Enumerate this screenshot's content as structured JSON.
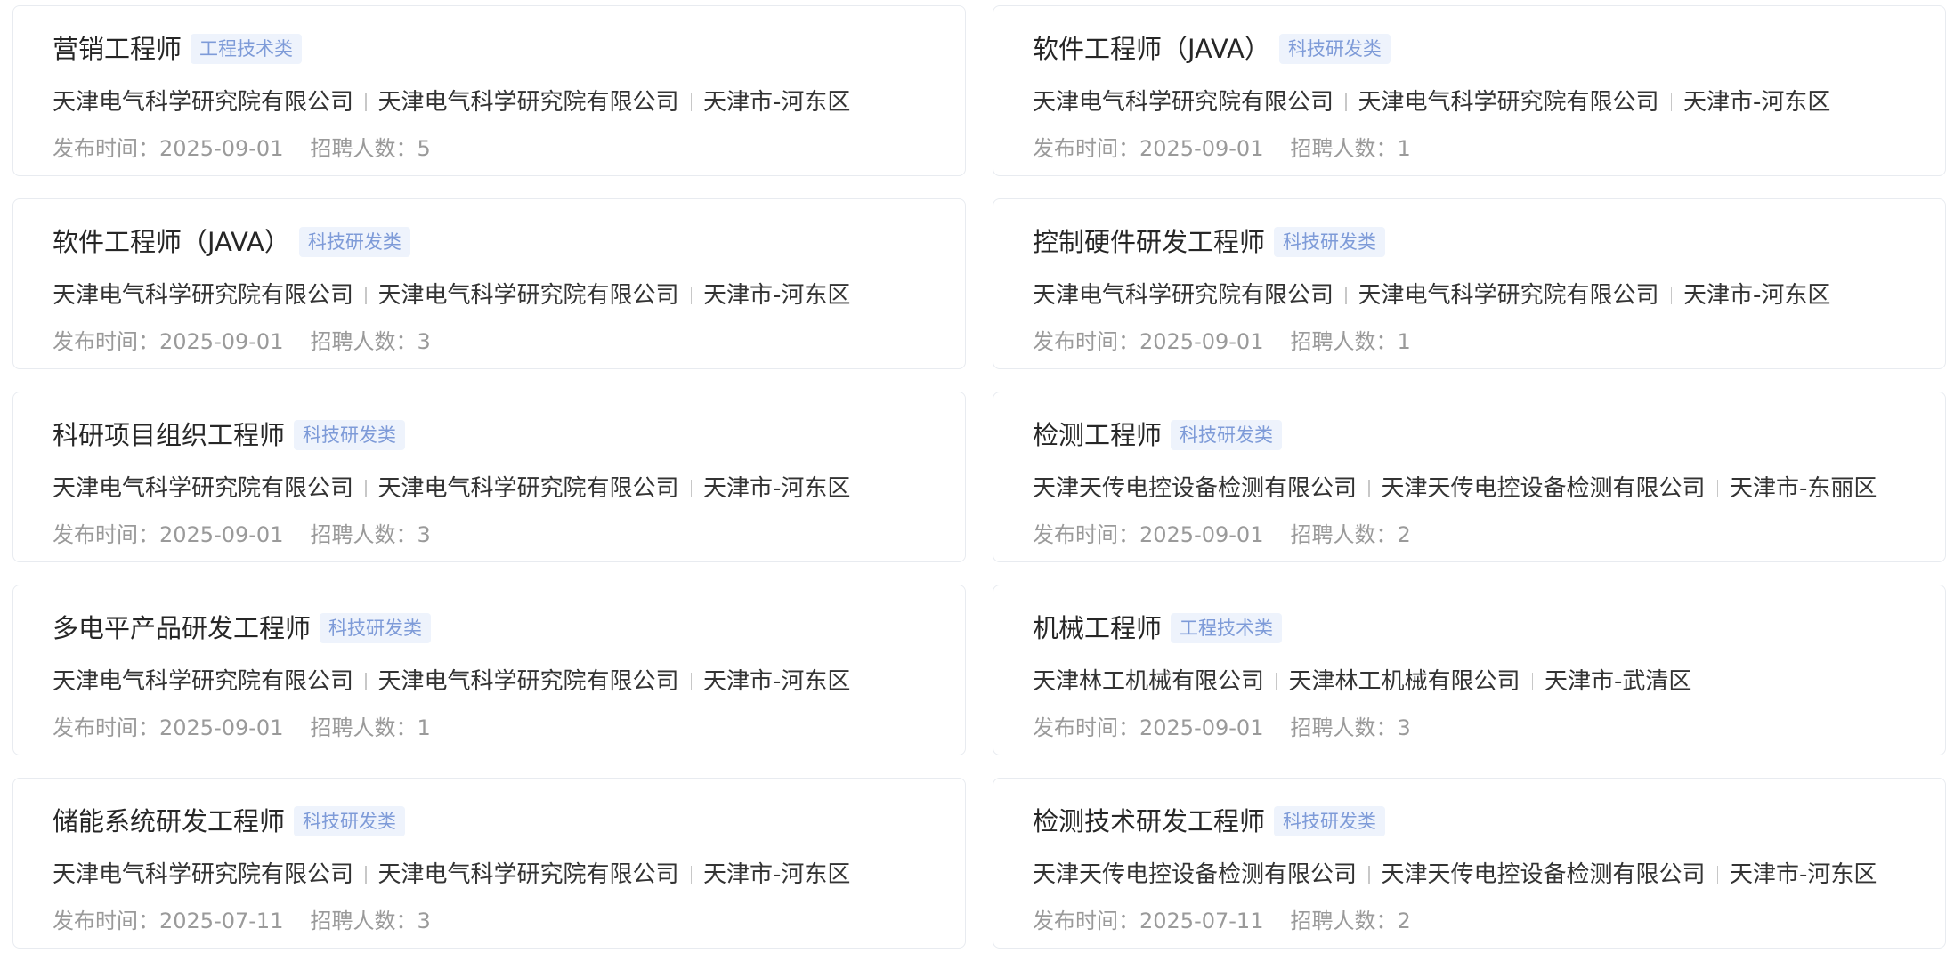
{
  "jobs": [
    {
      "title": "营销工程师",
      "tag": "工程技术类",
      "company1": "天津电气科学研究院有限公司",
      "company2": "天津电气科学研究院有限公司",
      "location": "天津市-河东区",
      "date_label": "发布时间：2025-09-01",
      "count_label": "招聘人数：5"
    },
    {
      "title": "软件工程师（JAVA）",
      "tag": "科技研发类",
      "company1": "天津电气科学研究院有限公司",
      "company2": "天津电气科学研究院有限公司",
      "location": "天津市-河东区",
      "date_label": "发布时间：2025-09-01",
      "count_label": "招聘人数：1"
    },
    {
      "title": "软件工程师（JAVA）",
      "tag": "科技研发类",
      "company1": "天津电气科学研究院有限公司",
      "company2": "天津电气科学研究院有限公司",
      "location": "天津市-河东区",
      "date_label": "发布时间：2025-09-01",
      "count_label": "招聘人数：3"
    },
    {
      "title": "控制硬件研发工程师",
      "tag": "科技研发类",
      "company1": "天津电气科学研究院有限公司",
      "company2": "天津电气科学研究院有限公司",
      "location": "天津市-河东区",
      "date_label": "发布时间：2025-09-01",
      "count_label": "招聘人数：1"
    },
    {
      "title": "科研项目组织工程师",
      "tag": "科技研发类",
      "company1": "天津电气科学研究院有限公司",
      "company2": "天津电气科学研究院有限公司",
      "location": "天津市-河东区",
      "date_label": "发布时间：2025-09-01",
      "count_label": "招聘人数：3"
    },
    {
      "title": "检测工程师",
      "tag": "科技研发类",
      "company1": "天津天传电控设备检测有限公司",
      "company2": "天津天传电控设备检测有限公司",
      "location": "天津市-东丽区",
      "date_label": "发布时间：2025-09-01",
      "count_label": "招聘人数：2"
    },
    {
      "title": "多电平产品研发工程师",
      "tag": "科技研发类",
      "company1": "天津电气科学研究院有限公司",
      "company2": "天津电气科学研究院有限公司",
      "location": "天津市-河东区",
      "date_label": "发布时间：2025-09-01",
      "count_label": "招聘人数：1"
    },
    {
      "title": "机械工程师",
      "tag": "工程技术类",
      "company1": "天津林工机械有限公司",
      "company2": "天津林工机械有限公司",
      "location": "天津市-武清区",
      "date_label": "发布时间：2025-09-01",
      "count_label": "招聘人数：3"
    },
    {
      "title": "储能系统研发工程师",
      "tag": "科技研发类",
      "company1": "天津电气科学研究院有限公司",
      "company2": "天津电气科学研究院有限公司",
      "location": "天津市-河东区",
      "date_label": "发布时间：2025-07-11",
      "count_label": "招聘人数：3"
    },
    {
      "title": "检测技术研发工程师",
      "tag": "科技研发类",
      "company1": "天津天传电控设备检测有限公司",
      "company2": "天津天传电控设备检测有限公司",
      "location": "天津市-河东区",
      "date_label": "发布时间：2025-07-11",
      "count_label": "招聘人数：2"
    }
  ]
}
